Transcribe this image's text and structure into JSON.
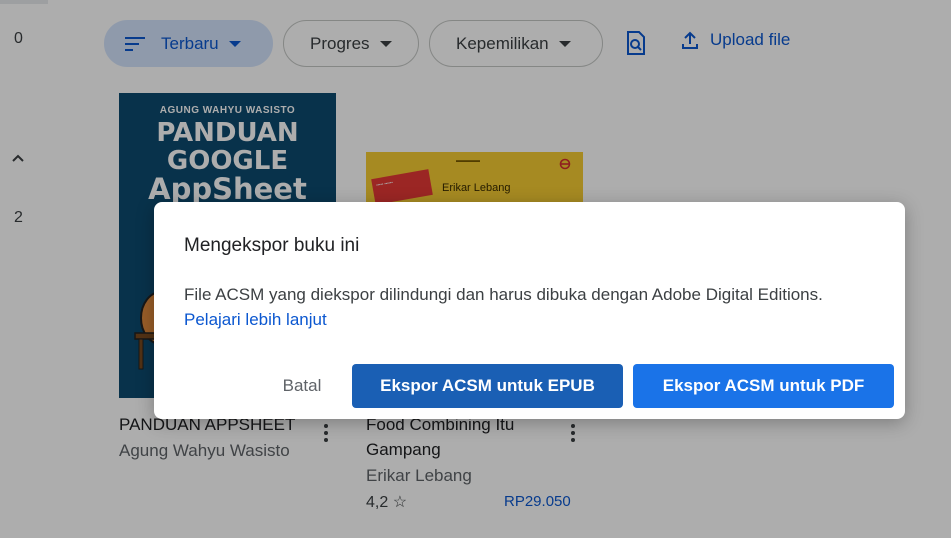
{
  "rail": {
    "num_top": "0",
    "num_bottom": "2"
  },
  "filters": {
    "sort_label": "Terbaru",
    "progress_label": "Progres",
    "ownership_label": "Kepemilikan",
    "upload_label": "Upload file"
  },
  "books": [
    {
      "title": "PANDUAN APPSHEET",
      "author": "Agung Wahyu Wasisto",
      "cover": {
        "author": "AGUNG WAHYU WASISTO",
        "line1": "PANDUAN",
        "line2": "GOOGLE",
        "line3": "AppSheet"
      }
    },
    {
      "title_line1": "Food Combining Itu",
      "title_line2": "Gampang",
      "author": "Erikar Lebang",
      "rating": "4,2 ☆",
      "price": "RP29.050",
      "cover": {
        "author": "Erikar Lebang"
      }
    }
  ],
  "dialog": {
    "title": "Mengekspor buku ini",
    "body": "File ACSM yang diekspor dilindungi dan harus dibuka dengan Adobe Digital Editions.",
    "link": "Pelajari lebih lanjut",
    "cancel": "Batal",
    "export_epub": "Ekspor ACSM untuk EPUB",
    "export_pdf": "Ekspor ACSM untuk PDF"
  },
  "colors": {
    "accent": "#1a73e8",
    "chip_active_bg": "#d3e3fd",
    "link": "#0b57d0",
    "cover1_bg": "#0d4a6f",
    "cover2_bg": "#f5cc33"
  }
}
